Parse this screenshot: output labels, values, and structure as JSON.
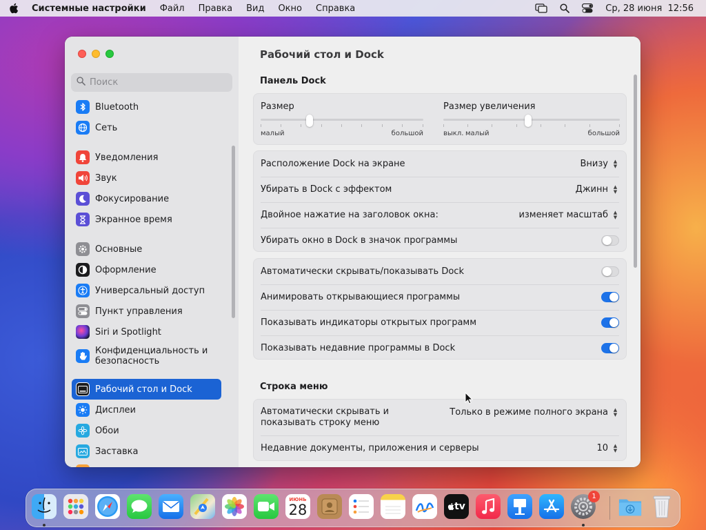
{
  "menubar": {
    "app_name": "Системные настройки",
    "items": [
      "Файл",
      "Правка",
      "Вид",
      "Окно",
      "Справка"
    ],
    "datetime": "Ср, 28 июня  12:56"
  },
  "sidebar": {
    "search_placeholder": "Поиск",
    "items": [
      {
        "label": "Bluetooth",
        "icon": "bluetooth-icon",
        "color": "#1a7cf5"
      },
      {
        "label": "Сеть",
        "icon": "globe-icon",
        "color": "#1a7cf5"
      },
      {
        "label": "Уведомления",
        "icon": "bell-icon",
        "color": "#f0453a"
      },
      {
        "label": "Звук",
        "icon": "speaker-icon",
        "color": "#f0453a"
      },
      {
        "label": "Фокусирование",
        "icon": "moon-icon",
        "color": "#5b4fd6"
      },
      {
        "label": "Экранное время",
        "icon": "hourglass-icon",
        "color": "#5b4fd6"
      },
      {
        "label": "Основные",
        "icon": "gear-icon",
        "color": "#8e8e93"
      },
      {
        "label": "Оформление",
        "icon": "appearance-icon",
        "color": "#1c1c1e"
      },
      {
        "label": "Универсальный доступ",
        "icon": "accessibility-icon",
        "color": "#1a7cf5"
      },
      {
        "label": "Пункт управления",
        "icon": "control-center-icon",
        "color": "#8e8e93"
      },
      {
        "label": "Siri и Spotlight",
        "icon": "siri-icon",
        "color": "#2a2a4a"
      },
      {
        "label": "Конфиденциальность и безопасность",
        "icon": "hand-icon",
        "color": "#1a7cf5"
      },
      {
        "label": "Рабочий стол и Dock",
        "icon": "dock-icon",
        "color": "#1c1c1e",
        "selected": true
      },
      {
        "label": "Дисплеи",
        "icon": "sun-icon",
        "color": "#1a7cf5"
      },
      {
        "label": "Обои",
        "icon": "flower-icon",
        "color": "#27a9e0"
      },
      {
        "label": "Заставка",
        "icon": "screensaver-icon",
        "color": "#27a9e0"
      }
    ]
  },
  "main": {
    "title": "Рабочий стол и Dock",
    "dock_section": "Панель Dock",
    "size": {
      "label": "Размер",
      "min": "малый",
      "max": "большой",
      "value": 0.3
    },
    "magnification": {
      "label": "Размер увеличения",
      "off": "выкл.",
      "min": "малый",
      "max": "большой",
      "value": 0.48
    },
    "position": {
      "label": "Расположение Dock на экране",
      "value": "Внизу"
    },
    "minimize_effect": {
      "label": "Убирать в Dock с эффектом",
      "value": "Джинн"
    },
    "double_click": {
      "label": "Двойное нажатие на заголовок окна:",
      "value": "изменяет масштаб"
    },
    "minimize_to_icon": {
      "label": "Убирать окно в Dock в значок программы",
      "on": false
    },
    "autohide": {
      "label": "Автоматически скрывать/показывать Dock",
      "on": false
    },
    "animate": {
      "label": "Анимировать открывающиеся программы",
      "on": true
    },
    "indicators": {
      "label": "Показывать индикаторы открытых программ",
      "on": true
    },
    "recent": {
      "label": "Показывать недавние программы в Dock",
      "on": true
    },
    "menubar_section": "Строка меню",
    "menubar_autohide": {
      "label": "Автоматически скрывать и показывать строку меню",
      "value": "Только в режиме полного экрана"
    },
    "recent_docs": {
      "label": "Недавние документы, приложения и серверы",
      "value": "10"
    }
  },
  "dock": {
    "apps": [
      "Finder",
      "Launchpad",
      "Safari",
      "Messages",
      "Mail",
      "Maps",
      "Photos",
      "FaceTime",
      "Calendar",
      "Contacts",
      "Reminders",
      "Notes",
      "Freeform",
      "TV",
      "Music",
      "Keynote",
      "App Store",
      "System Settings"
    ],
    "calendar_month": "ИЮНЬ",
    "calendar_day": "28",
    "tv_label": "tv",
    "settings_badge": "1"
  },
  "colors": {
    "accent": "#1b63d4",
    "toggle_on": "#1d72e8"
  }
}
